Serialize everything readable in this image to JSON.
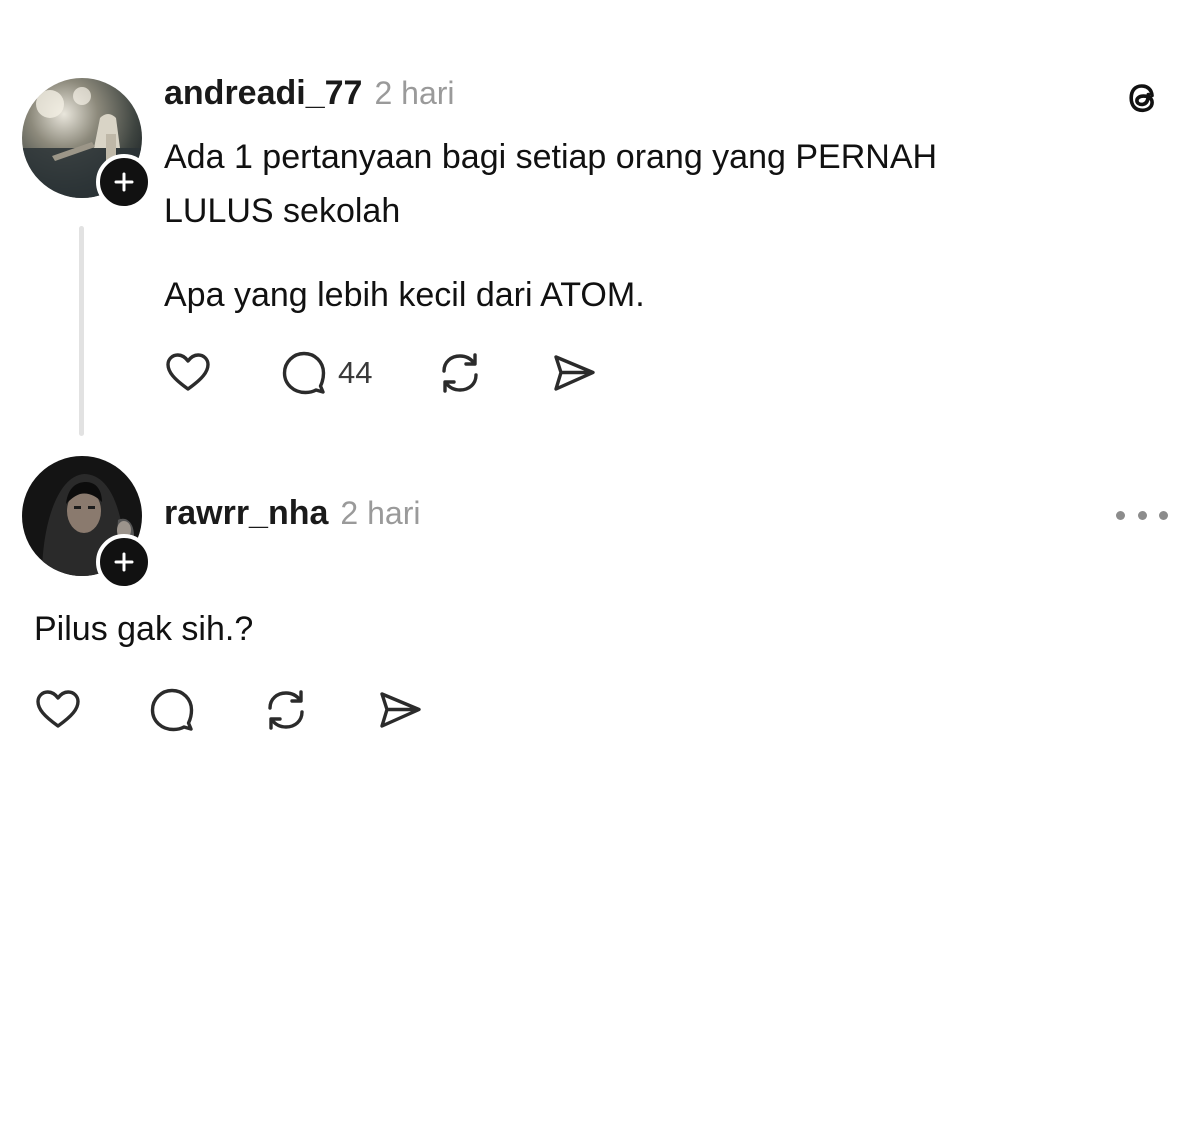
{
  "post": {
    "username": "andreadi_77",
    "time": "2 hari",
    "paragraph1_line1": "Ada 1 pertanyaan bagi setiap orang yang PERNAH",
    "paragraph1_line2": "LULUS sekolah",
    "paragraph2": "Apa yang lebih kecil dari ATOM.",
    "reply_count": "44",
    "icons": [
      "heart-icon",
      "comment-icon",
      "repost-icon",
      "share-icon",
      "threads-logo-icon",
      "plus-icon"
    ]
  },
  "reply": {
    "username": "rawrr_nha",
    "time": "2 hari",
    "text": "Pilus gak sih.?",
    "icons": [
      "heart-icon",
      "comment-icon",
      "repost-icon",
      "share-icon",
      "more-icon",
      "plus-icon"
    ]
  },
  "colors": {
    "text": "#111111",
    "muted": "#9a9a9a",
    "thread_line": "#e2e2e2",
    "badge": "#111111"
  }
}
